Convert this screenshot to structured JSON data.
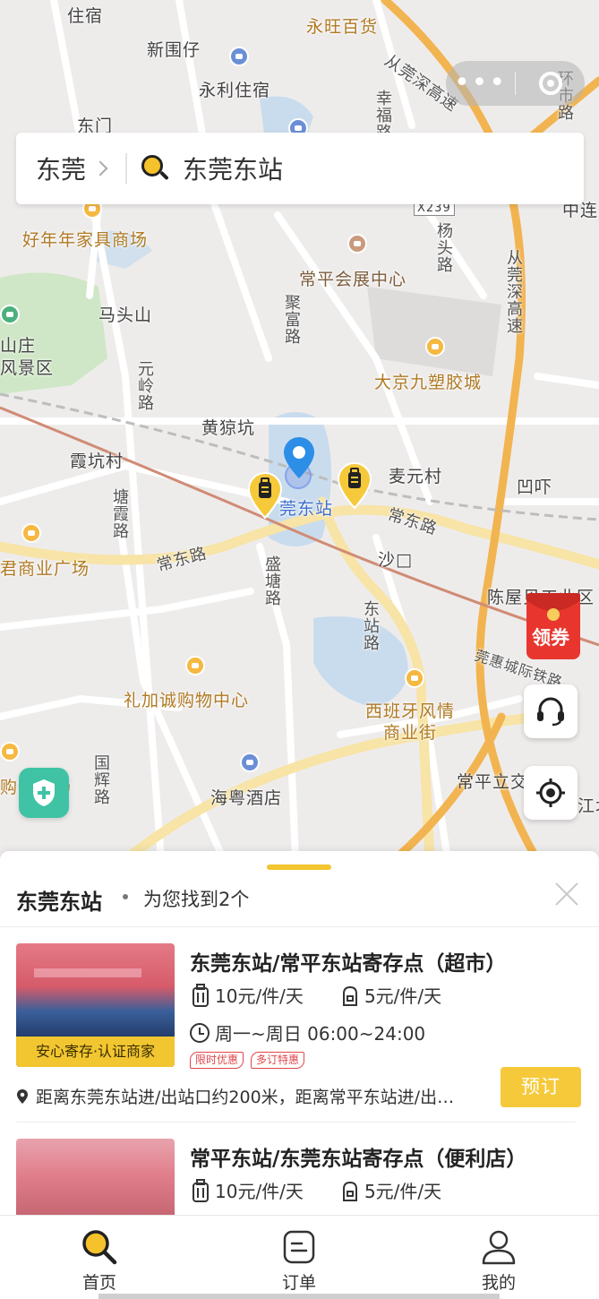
{
  "search": {
    "city": "东莞",
    "query": "东莞东站"
  },
  "map": {
    "labels": {
      "xinweizai": "新围仔",
      "yongli": "永利住宿",
      "dongmen": "东门",
      "zhusu": "住宿",
      "yongwang": "永旺百货",
      "congguan": "从莞深高速",
      "haonian": "好年年家具商场",
      "x239": "X239",
      "huizhan": "常平会展中心",
      "matoushan": "马头山",
      "jingqu": "山庄\n风景区",
      "dajing": "大京九塑胶城",
      "huangyuankeng": "黄猄坑",
      "xiakengcun": "霞坑村",
      "maiyuancun": "麦元村",
      "aoxia": "凹吓",
      "station": "莞东站",
      "changdonglu1": "常东路",
      "changdonglu2": "常东路",
      "shapu": "沙□",
      "shangyeguangchang": "君商业广场",
      "chenwu": "陈屋贝工业区",
      "lijiacheng": "礼加诚购物中心",
      "xibanya": "西班牙风情\n商业街",
      "guanhui": "莞惠城际铁路",
      "haiyue": "海粤酒店",
      "changpinglijiao": "常平立交",
      "gouwuguangchang": "购物广场",
      "jiangbei": "江北",
      "tanglian": "中连",
      "lianghuilu": "杨头路",
      "xingfu": "幸福路",
      "juxilu": "聚富路",
      "yuanlingu": "元岭路",
      "tangxialu": "塘霞路",
      "shengtanglu": "盛塘路",
      "dongzhanlu": "东站路",
      "guohuilu": "国辉路",
      "huanshi": "环市路",
      "congguanvert": "从莞深高速"
    }
  },
  "capsule": {
    "more": "•••"
  },
  "float": {
    "coupon": "领券"
  },
  "sheet": {
    "title": "东莞东站",
    "count": "为您找到2个",
    "stores": [
      {
        "name": "东莞东站/常平东站寄存点（超市）",
        "luggage_price": "10元/件/天",
        "bag_price": "5元/件/天",
        "hours": "周一~周日 06:00~24:00",
        "thumb_tag": "安心寄存·认证商家",
        "badges": [
          "限时优惠",
          "多订特惠"
        ],
        "address": "距离东莞东站进/出站口约200米，距离常平东站进/出…",
        "book": "预订"
      },
      {
        "name": "常平东站/东莞东站寄存点（便利店）",
        "luggage_price": "10元/件/天",
        "bag_price": "5元/件/天"
      }
    ]
  },
  "tabs": [
    {
      "label": "首页",
      "icon": "search-icon"
    },
    {
      "label": "订单",
      "icon": "order-icon"
    },
    {
      "label": "我的",
      "icon": "user-icon"
    }
  ],
  "colors": {
    "accent": "#f5c93a",
    "badge": "#e0474b",
    "shield": "#3fc3a4"
  }
}
